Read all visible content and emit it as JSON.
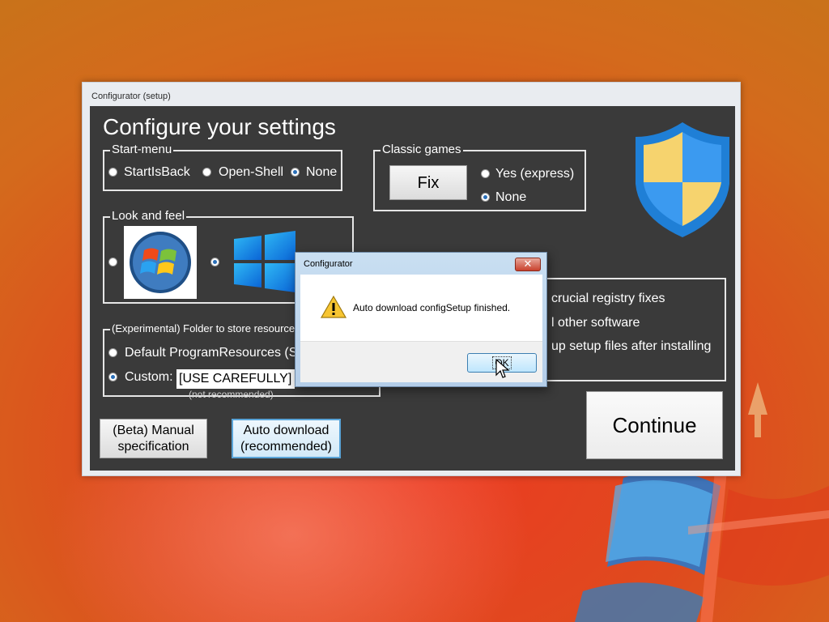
{
  "window": {
    "title": "Configurator (setup)"
  },
  "heading": "Configure your settings",
  "start_menu": {
    "legend": "Start-menu",
    "options": [
      "StartIsBack",
      "Open-Shell",
      "None"
    ],
    "selected": "None"
  },
  "classic_games": {
    "legend": "Classic games",
    "fix_button": "Fix",
    "options": [
      "Yes (express)",
      "None"
    ],
    "selected": "None"
  },
  "look_and_feel": {
    "legend": "Look and feel",
    "images": [
      "windows-7-logo",
      "windows-11-logo"
    ],
    "selected": "windows-11-logo"
  },
  "folder": {
    "legend": "(Experimental) Folder to store resource",
    "default_option": "Default ProgramResources (S",
    "custom_label": "Custom:",
    "custom_value": "[USE CAREFULLY]",
    "note": "(not recommended)",
    "selected": "Custom"
  },
  "extras": {
    "line1": "crucial registry fixes",
    "line2": "l other software",
    "line3": "up setup files after installing"
  },
  "buttons": {
    "manual": [
      "(Beta) Manual",
      "specification"
    ],
    "auto": [
      "Auto download",
      "(recommended)"
    ],
    "continue": "Continue"
  },
  "dialog": {
    "title": "Configurator",
    "close": "✕",
    "message": "Auto download configSetup finished.",
    "ok": "OK",
    "icon": "warning-icon"
  },
  "colors": {
    "panel": "#3a3a3a",
    "shield_blue": "#2f8be0",
    "shield_yellow": "#f5d36a"
  }
}
